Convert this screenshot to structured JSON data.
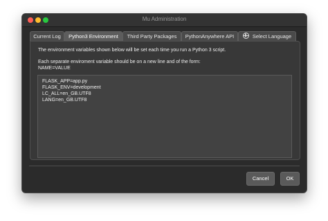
{
  "window": {
    "title": "Mu Administration"
  },
  "tabs": [
    {
      "label": "Current Log",
      "active": false
    },
    {
      "label": "Python3 Environment",
      "active": true
    },
    {
      "label": "Third Party Packages",
      "active": false
    },
    {
      "label": "PythonAnywhere API",
      "active": false
    },
    {
      "label": "Select Language",
      "active": false,
      "icon": "globe-icon"
    }
  ],
  "panel": {
    "intro_line_1": "The environment variables shown below will be set each time you run a Python 3 script.",
    "intro_line_2": "Each separate enviroment variable should be on a new line and of the form:",
    "intro_line_3": "NAME=VALUE",
    "env_variables": [
      "FLASK_APP=app.py",
      "FLASK_ENV=development",
      "LC_ALL=en_GB.UTF8",
      "LANG=en_GB.UTF8"
    ]
  },
  "buttons": {
    "cancel_label": "Cancel",
    "ok_label": "OK"
  },
  "colors": {
    "window_background": "#2b2b2b",
    "panel_background": "#383838",
    "editor_background": "#424242",
    "close_button": "#ff5f57",
    "minimize_button": "#febc2e",
    "maximize_button": "#28c840"
  }
}
